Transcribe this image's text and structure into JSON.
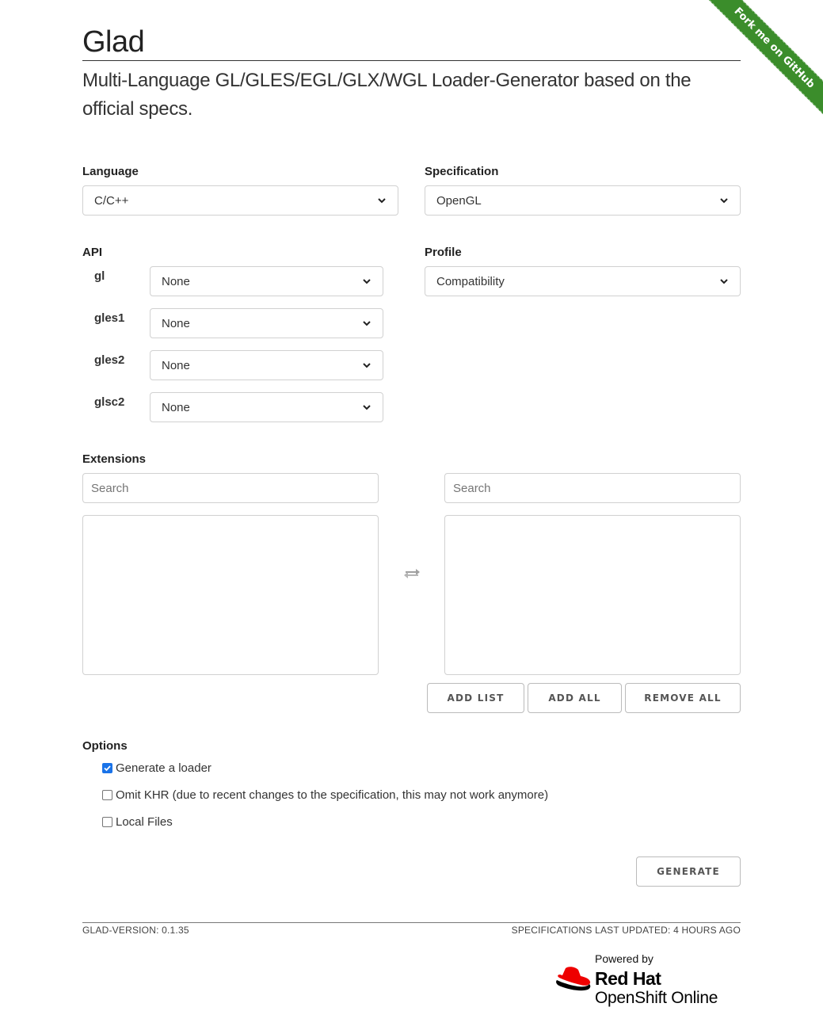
{
  "ribbon": {
    "label": "Fork me on GitHub"
  },
  "header": {
    "title": "Glad",
    "subtitle": "Multi-Language GL/GLES/EGL/GLX/WGL Loader-Generator based on the official specs."
  },
  "language": {
    "label": "Language",
    "value": "C/C++"
  },
  "specification": {
    "label": "Specification",
    "value": "OpenGL"
  },
  "api": {
    "label": "API",
    "rows": [
      {
        "name": "gl",
        "value": "None"
      },
      {
        "name": "gles1",
        "value": "None"
      },
      {
        "name": "gles2",
        "value": "None"
      },
      {
        "name": "glsc2",
        "value": "None"
      }
    ]
  },
  "profile": {
    "label": "Profile",
    "value": "Compatibility"
  },
  "extensions": {
    "label": "Extensions",
    "left_search_placeholder": "Search",
    "right_search_placeholder": "Search",
    "buttons": {
      "add_list": "ADD LIST",
      "add_all": "ADD ALL",
      "remove_all": "REMOVE ALL"
    }
  },
  "options": {
    "label": "Options",
    "items": [
      {
        "label": "Generate a loader",
        "checked": true
      },
      {
        "label": "Omit KHR (due to recent changes to the specification, this may not work anymore)",
        "checked": false
      },
      {
        "label": "Local Files",
        "checked": false
      }
    ]
  },
  "generate": {
    "label": "GENERATE"
  },
  "footer": {
    "version": "GLAD-VERSION: 0.1.35",
    "updated": "SPECIFICATIONS LAST UPDATED: 4 HOURS AGO"
  },
  "powered_by": {
    "label": "Powered by",
    "brand_line1": "Red Hat",
    "brand_line2": "OpenShift Online"
  },
  "colors": {
    "ribbon": "#3b8d2b",
    "checkbox": "#1a73e8",
    "redhat": "#ee0000"
  }
}
